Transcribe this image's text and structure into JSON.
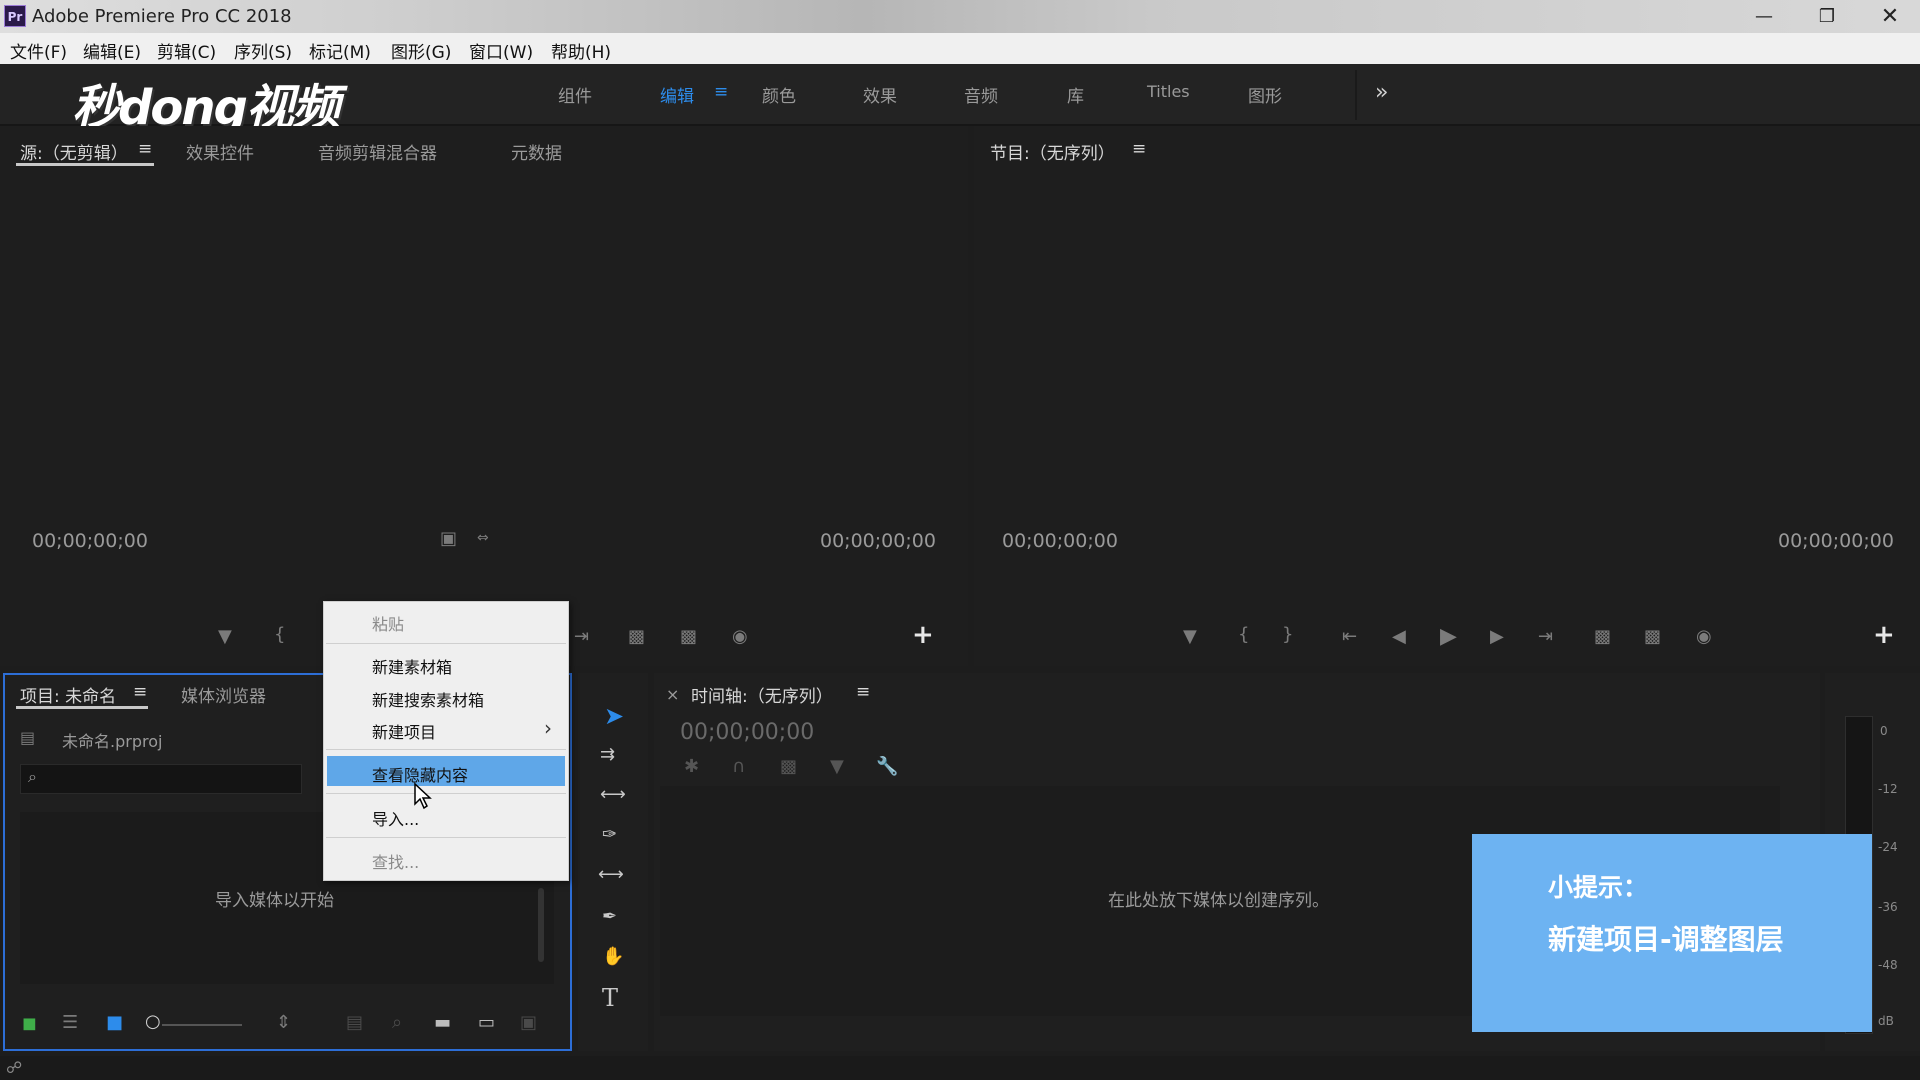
{
  "window": {
    "title": "Adobe Premiere Pro CC 2018",
    "icon_text": "Pr"
  },
  "menu": [
    "文件(F)",
    "编辑(E)",
    "剪辑(C)",
    "序列(S)",
    "标记(M)",
    "图形(G)",
    "窗口(W)",
    "帮助(H)"
  ],
  "watermark": "秒dong视频",
  "workspaces": [
    "组件",
    "编辑",
    "颜色",
    "效果",
    "音频",
    "库",
    "Titles",
    "图形"
  ],
  "workspace_menu_icon": "≡",
  "workspace_more": "»",
  "source_panel": {
    "tabs": [
      "源:（无剪辑）",
      "效果控件",
      "音频剪辑混合器",
      "元数据"
    ],
    "timecode_left": "00;00;00;00",
    "timecode_right": "00;00;00;00"
  },
  "program_panel": {
    "title": "节目:（无序列）",
    "timecode_left": "00;00;00;00",
    "timecode_right": "00;00;00;00"
  },
  "project_panel": {
    "tabs": [
      "项目: 未命名",
      "媒体浏览器"
    ],
    "file_name": "未命名.prproj",
    "empty_text": "导入媒体以开始"
  },
  "timeline_panel": {
    "close": "×",
    "title": "时间轴:（无序列）",
    "timecode": "00;00;00;00",
    "empty_text": "在此处放下媒体以创建序列。"
  },
  "context_menu": {
    "items": [
      "粘贴",
      "新建素材箱",
      "新建搜索素材箱",
      "新建项目",
      "查看隐藏内容",
      "导入...",
      "查找..."
    ],
    "submenu_arrow": "›"
  },
  "meter": {
    "ticks": [
      "0",
      "-12",
      "-24",
      "-36",
      "-48",
      "dB"
    ]
  },
  "tip": {
    "line1": "小提示：",
    "line2": "新建项目-调整图层"
  },
  "colors": {
    "accent": "#2d8ceb",
    "tip_bg": "#6db3f2",
    "highlight": "#5fa7e8"
  }
}
